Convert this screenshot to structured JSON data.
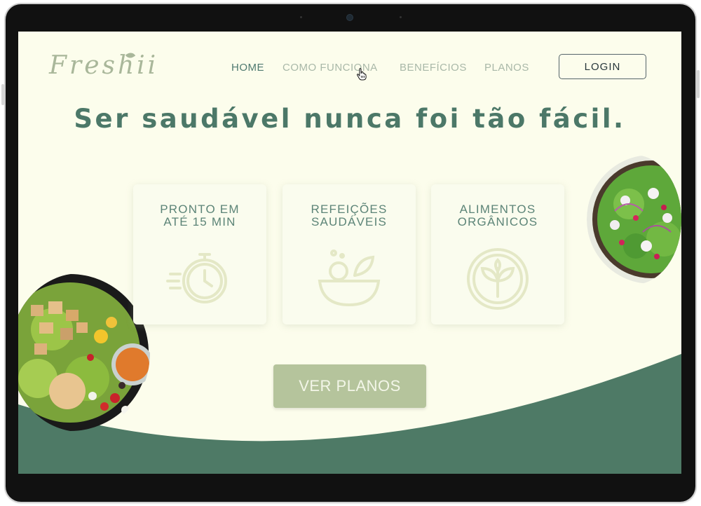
{
  "brand": {
    "logo_text": "Freshii"
  },
  "nav": {
    "items": [
      "HOME",
      "COMO FUNCIONA",
      "BENEFÍCIOS",
      "PLANOS"
    ],
    "active": "HOME",
    "login_label": "LOGIN"
  },
  "hero": {
    "headline": "Ser saudável nunca foi tão fácil."
  },
  "features": [
    {
      "title": "PRONTO EM\nATÉ 15 MIN",
      "icon": "stopwatch-icon"
    },
    {
      "title": "REFEIÇÕES\nSAUDÁVEIS",
      "icon": "salad-bowl-icon"
    },
    {
      "title": "ALIMENTOS\nORGÂNICOS",
      "icon": "organic-leaf-icon"
    }
  ],
  "cta": {
    "label": "VER PLANOS"
  },
  "colors": {
    "background": "#fcfdec",
    "primary_green": "#4e7a66",
    "muted_green": "#b5c49c",
    "text_green": "#4c7868"
  }
}
